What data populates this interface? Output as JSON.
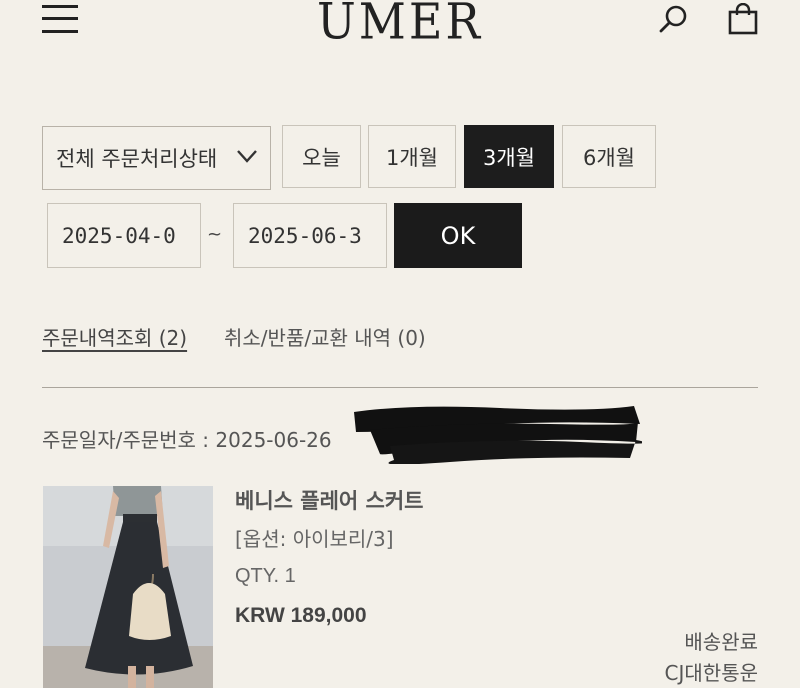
{
  "header": {
    "logo": "UMER",
    "menu_icon": "hamburger-menu-icon",
    "search_icon": "search-icon",
    "cart_icon": "shopping-bag-icon"
  },
  "filter": {
    "status_select": "전체 주문처리상태",
    "periods": [
      "오늘",
      "1개월",
      "3개월",
      "6개월"
    ],
    "selected_period": "3개월",
    "start_date": "2025-04-0",
    "end_date": "2025-06-3",
    "separator": "~",
    "ok_label": "OK"
  },
  "tabs": {
    "orders": "주문내역조회 (2)",
    "cancel": "취소/반품/교환 내역 (0)"
  },
  "order": {
    "info_label": "주문일자/주문번호 : 2025-06-26",
    "product_name": "베니스 플레어 스커트",
    "option": "[옵션: 아이보리/3]",
    "qty": "QTY. 1",
    "price": "KRW 189,000",
    "status": "배송완료",
    "carrier": "CJ대한통운"
  },
  "colors": {
    "background": "#f3f0e9",
    "selected": "#1d1d1d",
    "border": "#c9c4ba"
  }
}
